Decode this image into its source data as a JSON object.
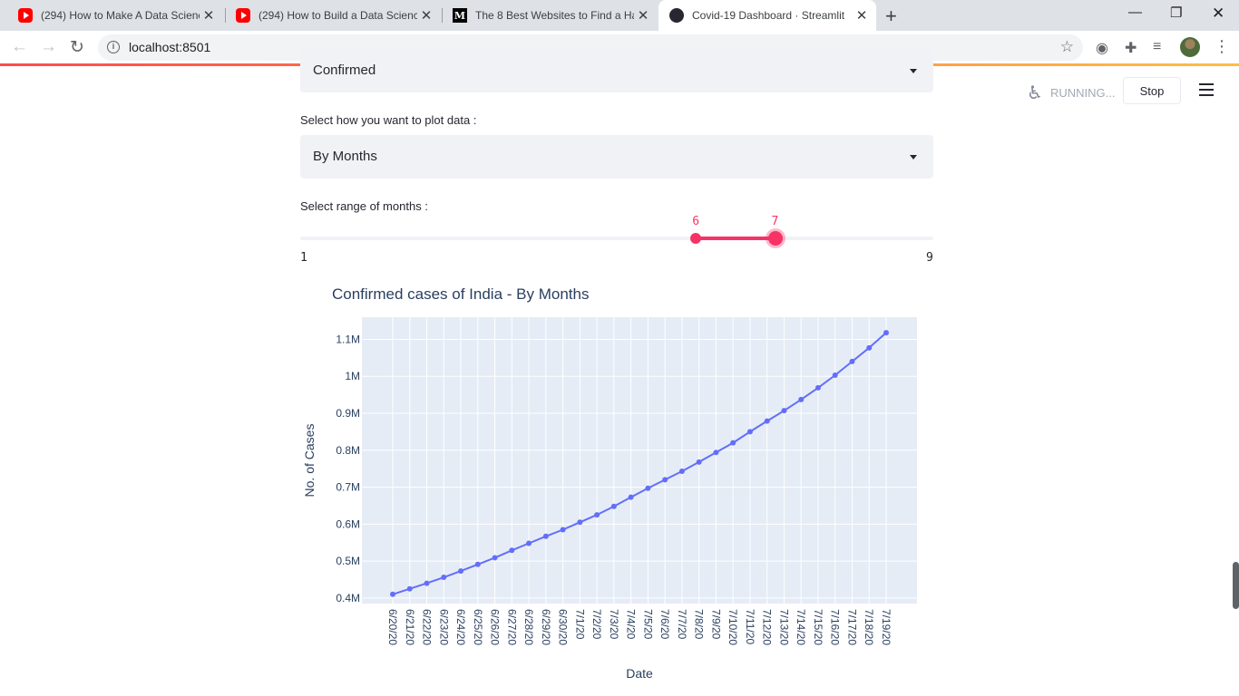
{
  "browser": {
    "tabs": [
      {
        "title": "(294) How to Make A Data Scienc",
        "icon": "youtube-icon",
        "active": false
      },
      {
        "title": "(294) How to Build a Data Scienc",
        "icon": "youtube-icon",
        "active": false
      },
      {
        "title": "The 8 Best Websites to Find a Ha",
        "icon": "medium-icon",
        "active": false
      },
      {
        "title": "Covid-19 Dashboard · Streamlit",
        "icon": "streamlit-icon",
        "active": true
      }
    ],
    "url": "localhost:8501",
    "medium_letter": "M"
  },
  "app": {
    "status": "RUNNING...",
    "stop_label": "Stop",
    "case_select": {
      "value": "Confirmed"
    },
    "plot_label": "Select how you want to plot data :",
    "plot_select": {
      "value": "By Months"
    },
    "range_label": "Select range of months :",
    "range": {
      "min": 1,
      "max": 9,
      "low": 6,
      "high": 7
    },
    "accent": "#f63366"
  },
  "chart_data": {
    "type": "line",
    "title": "Confirmed cases of India - By Months",
    "xlabel": "Date",
    "ylabel": "No. of Cases",
    "y_ticks": [
      400000,
      500000,
      600000,
      700000,
      800000,
      900000,
      1000000,
      1100000
    ],
    "y_tick_labels": [
      "0.4M",
      "0.5M",
      "0.6M",
      "0.7M",
      "0.8M",
      "0.9M",
      "1M",
      "1.1M"
    ],
    "categories": [
      "6/20/20",
      "6/21/20",
      "6/22/20",
      "6/23/20",
      "6/24/20",
      "6/25/20",
      "6/26/20",
      "6/27/20",
      "6/28/20",
      "6/29/20",
      "6/30/20",
      "7/1/20",
      "7/2/20",
      "7/3/20",
      "7/4/20",
      "7/5/20",
      "7/6/20",
      "7/7/20",
      "7/8/20",
      "7/9/20",
      "7/10/20",
      "7/11/20",
      "7/12/20",
      "7/13/20",
      "7/14/20",
      "7/15/20",
      "7/16/20",
      "7/17/20",
      "7/18/20",
      "7/19/20"
    ],
    "series": [
      {
        "values": [
          410000,
          425000,
          440000,
          456000,
          473000,
          491000,
          509000,
          529000,
          548000,
          567000,
          585000,
          605000,
          625000,
          648000,
          673000,
          697000,
          720000,
          743000,
          768000,
          794000,
          820000,
          850000,
          879000,
          907000,
          937000,
          969000,
          1003000,
          1040000,
          1077000,
          1118000
        ],
        "color": "#636efa"
      }
    ],
    "plot_bg": "#e5ecf6",
    "grid": true
  }
}
